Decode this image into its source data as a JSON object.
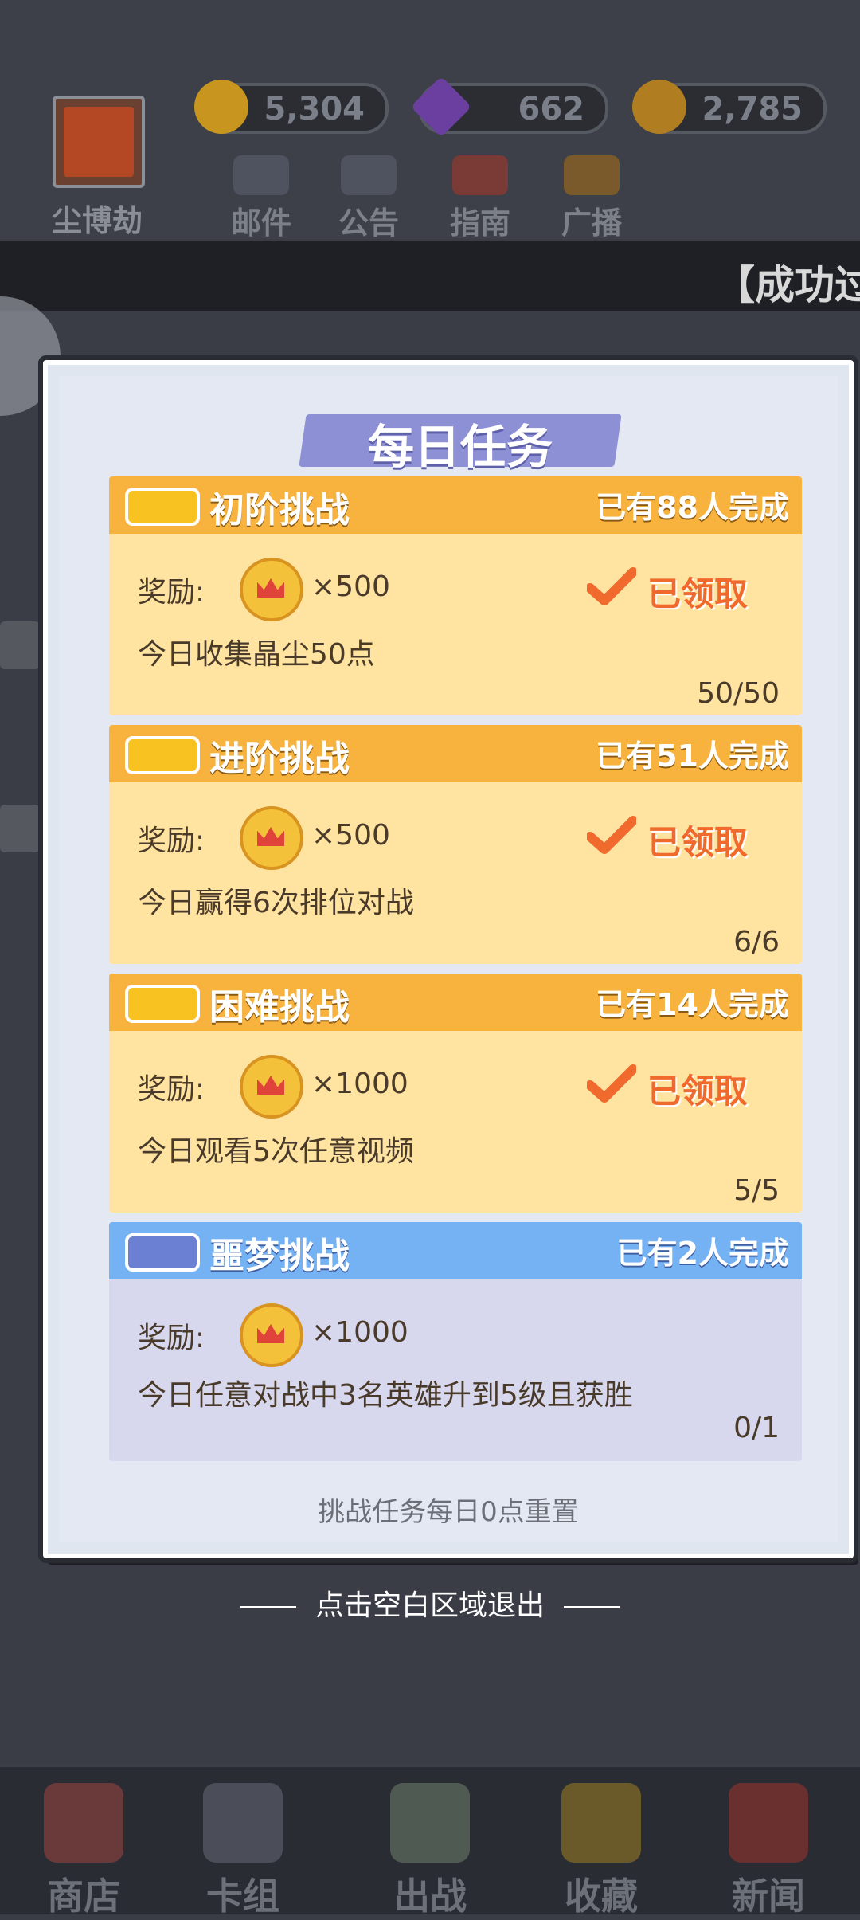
{
  "profile": {
    "name": "尘博劫"
  },
  "currencies": [
    {
      "icon": "crown-coin-icon",
      "value": "5,304"
    },
    {
      "icon": "gem-icon",
      "value": "662"
    },
    {
      "icon": "star-coin-icon",
      "value": "2,785"
    }
  ],
  "top_icons": [
    {
      "icon": "mail-icon",
      "label": "邮件"
    },
    {
      "icon": "announcement-icon",
      "label": "公告"
    },
    {
      "icon": "guide-book-icon",
      "label": "指南"
    },
    {
      "icon": "broadcast-icon",
      "label": "广播"
    }
  ],
  "ticker": {
    "text": "【成功过"
  },
  "modal": {
    "title": "每日任务",
    "reward_label": "奖励:",
    "tasks": [
      {
        "name": "初阶挑战",
        "completed_count": "已有88人完成",
        "amount": "×500",
        "status": "已领取",
        "desc": "今日收集晶尘50点",
        "progress": "50/50"
      },
      {
        "name": "进阶挑战",
        "completed_count": "已有51人完成",
        "amount": "×500",
        "status": "已领取",
        "desc": "今日赢得6次排位对战",
        "progress": "6/6"
      },
      {
        "name": "困难挑战",
        "completed_count": "已有14人完成",
        "amount": "×1000",
        "status": "已领取",
        "desc": "今日观看5次任意视频",
        "progress": "5/5"
      },
      {
        "name": "噩梦挑战",
        "completed_count": "已有2人完成",
        "amount": "×1000",
        "status": "",
        "desc": "今日任意对战中3名英雄升到5级且获胜",
        "progress": "0/1"
      }
    ],
    "footer_note": "挑战任务每日0点重置"
  },
  "exit_hint": "点击空白区域退出",
  "bottom_nav": [
    {
      "icon": "shop-icon",
      "label": "商店"
    },
    {
      "icon": "deck-icon",
      "label": "卡组"
    },
    {
      "icon": "battle-icon",
      "label": "出战"
    },
    {
      "icon": "collection-icon",
      "label": "收藏"
    },
    {
      "icon": "news-icon",
      "label": "新闻"
    }
  ],
  "colors": {
    "task_header_yellow": "#f7b33d",
    "task_body_yellow": "#ffe3a0",
    "task_header_blue": "#75b2f3",
    "claimed_orange": "#f06a2e",
    "title_ribbon": "#8e90d6"
  }
}
